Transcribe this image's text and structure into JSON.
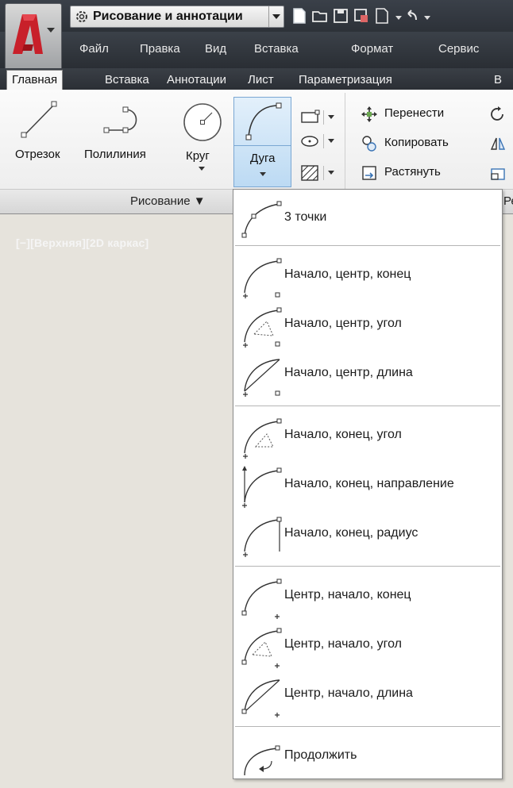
{
  "workspace": {
    "name": "Рисование и аннотации"
  },
  "menubar": [
    "Файл",
    "Правка",
    "Вид",
    "Вставка",
    "Формат",
    "Сервис"
  ],
  "tabs": [
    "Главная",
    "Вставка",
    "Аннотации",
    "Лист",
    "Параметризация",
    "В"
  ],
  "ribbon": {
    "line_label": "Отрезок",
    "polyline_label": "Полилиния",
    "circle_label": "Круг",
    "arc_label": "Дуга",
    "modify": [
      "Перенести",
      "Копировать",
      "Растянуть"
    ],
    "draw_panel_title": "Рисование ▼",
    "modify_panel_title_fragment": "Ре"
  },
  "viewport": {
    "label": "[−][Верхняя][2D каркас]"
  },
  "arc_menu": {
    "items": [
      "3 точки",
      "Начало, центр, конец",
      "Начало, центр, угол",
      "Начало, центр, длина",
      "Начало, конец, угол",
      "Начало, конец, направление",
      "Начало, конец, радиус",
      "Центр, начало, конец",
      "Центр, начало, угол",
      "Центр, начало, длина",
      "Продолжить"
    ]
  },
  "colors": {
    "accent_red": "#c8202a",
    "hover_blue": "#bcdaf3",
    "ribbon_dark": "#2b2f35"
  }
}
